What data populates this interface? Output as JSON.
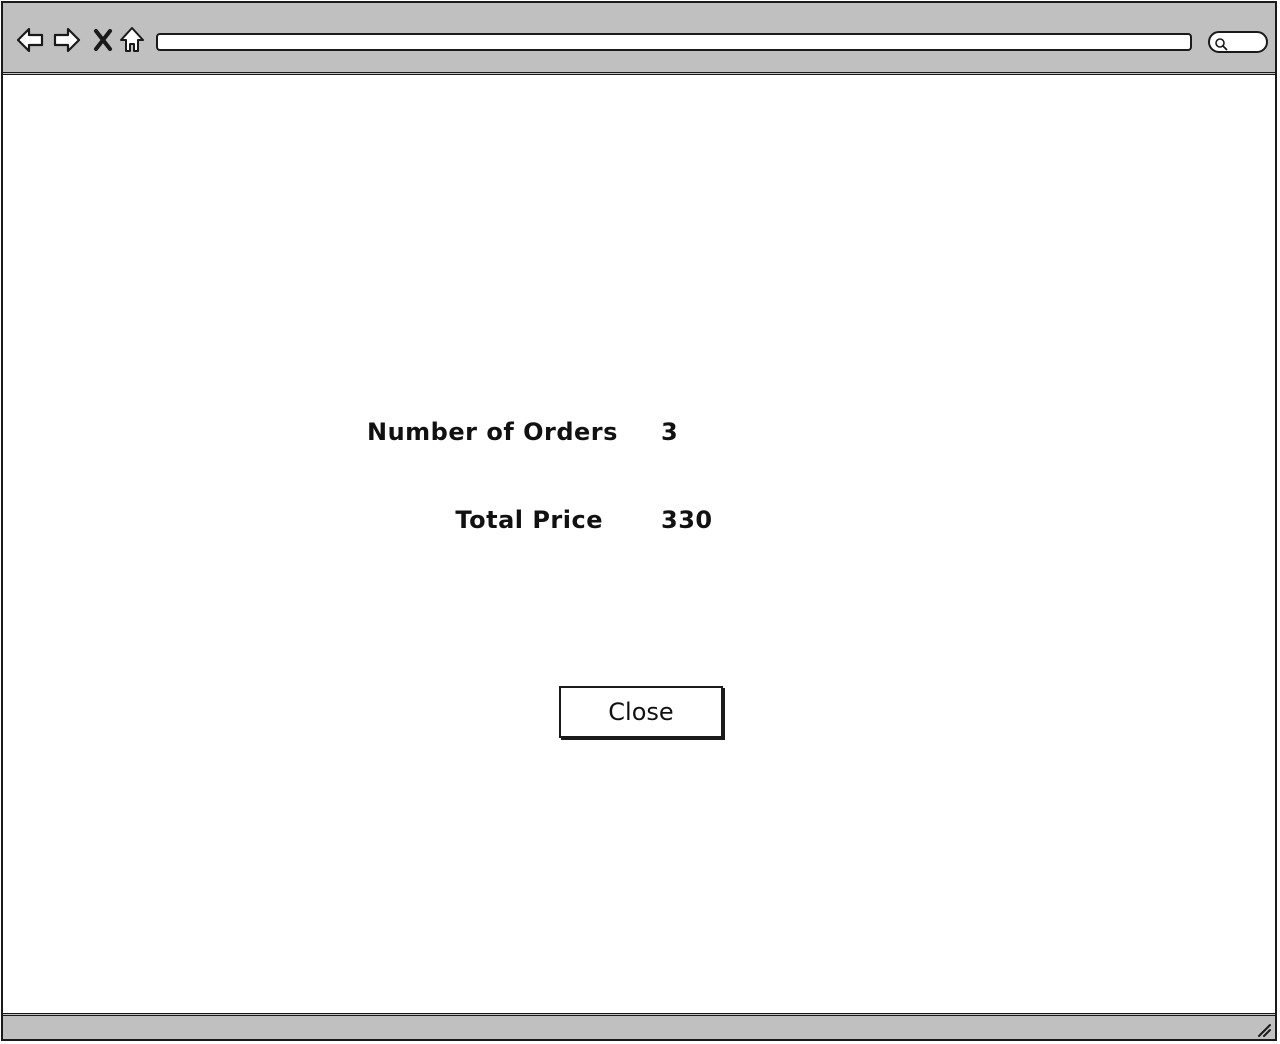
{
  "browser": {
    "toolbar": {
      "icons": [
        "back-arrow-icon",
        "forward-arrow-icon",
        "close-x-icon",
        "home-icon"
      ],
      "address_value": "",
      "search_icon": "search-icon"
    },
    "colors": {
      "chrome": "#c0c0c0",
      "outline": "#1a1a1a",
      "content_bg": "#ffffff"
    }
  },
  "summary": {
    "orders_label": "Number of Orders",
    "orders_value": "3",
    "price_label": "Total Price",
    "price_value": "330"
  },
  "actions": {
    "close_label": "Close"
  }
}
